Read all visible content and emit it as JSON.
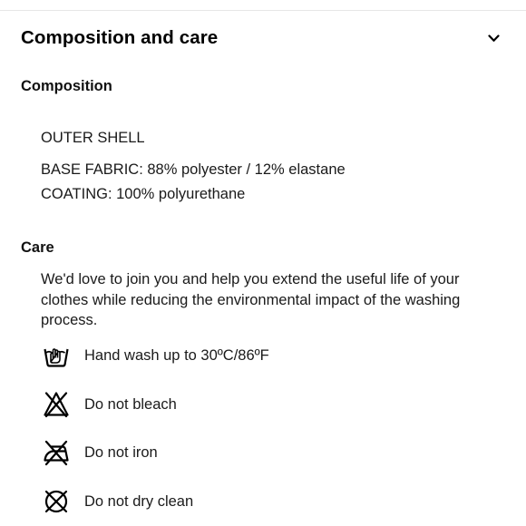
{
  "section": {
    "title": "Composition and care"
  },
  "composition": {
    "heading": "Composition",
    "group_title": "OUTER SHELL",
    "lines": [
      "BASE FABRIC: 88% polyester / 12% elastane",
      "COATING: 100% polyurethane"
    ]
  },
  "care": {
    "heading": "Care",
    "intro": "We'd love to join you and help you extend the useful life of your clothes while reducing the environmental impact of the washing process.",
    "items": [
      {
        "icon": "hand-wash-icon",
        "label": "Hand wash up to 30ºC/86ºF"
      },
      {
        "icon": "no-bleach-icon",
        "label": "Do not bleach"
      },
      {
        "icon": "no-iron-icon",
        "label": "Do not iron"
      },
      {
        "icon": "no-dry-clean-icon",
        "label": "Do not dry clean"
      }
    ]
  }
}
